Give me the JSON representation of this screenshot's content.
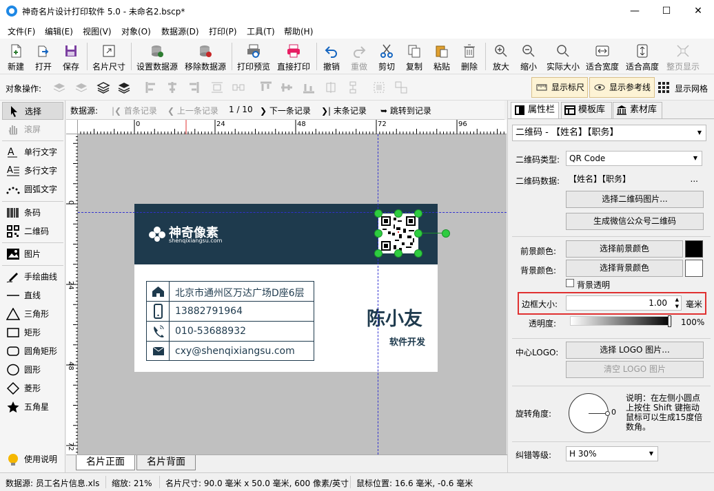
{
  "window": {
    "title": "神奇名片设计打印软件 5.0 - 未命名2.bscp*",
    "minimize": "—",
    "maximize": "☐",
    "close": "✕"
  },
  "menu": [
    "文件(F)",
    "编辑(E)",
    "视图(V)",
    "对象(O)",
    "数据源(D)",
    "打印(P)",
    "工具(T)",
    "帮助(H)"
  ],
  "toolbar": {
    "new": "新建",
    "open": "打开",
    "save": "保存",
    "card_size": "名片尺寸",
    "set_datasource": "设置数据源",
    "remove_datasource": "移除数据源",
    "print_preview": "打印预览",
    "direct_print": "直接打印",
    "undo": "撤销",
    "redo": "重做",
    "cut": "剪切",
    "copy": "复制",
    "paste": "粘贴",
    "delete": "删除",
    "zoom_in": "放大",
    "zoom_out": "缩小",
    "actual_size": "实际大小",
    "fit_width": "适合宽度",
    "fit_height": "适合高度",
    "fit_page": "整页显示"
  },
  "objbar": {
    "label": "对象操作:",
    "show_ruler": "显示标尺",
    "show_guides": "显示参考线",
    "show_grid": "显示网格"
  },
  "tools": {
    "select": "选择",
    "scroll": "滚屏",
    "single_text": "单行文字",
    "multi_text": "多行文字",
    "arc_text": "圆弧文字",
    "barcode": "条码",
    "qrcode": "二维码",
    "image": "图片",
    "freehand": "手绘曲线",
    "line": "直线",
    "triangle": "三角形",
    "rect": "矩形",
    "rounded_rect": "圆角矩形",
    "circle": "圆形",
    "diamond": "菱形",
    "star": "五角星",
    "help": "使用说明"
  },
  "datasource_nav": {
    "label": "数据源:",
    "first": "首条记录",
    "prev": "上一条记录",
    "position": "1 / 10",
    "next": "下一条记录",
    "last": "末条记录",
    "jump": "跳转到记录"
  },
  "ruler": {
    "h_ticks": [
      "0",
      "24",
      "48",
      "72",
      "96"
    ],
    "v_ticks": [
      "0",
      "24",
      "48",
      "72"
    ]
  },
  "card": {
    "logo_text": "神奇像素",
    "logo_sub": "shenqixiangsu.com",
    "contacts": [
      "北京市通州区万达广场D座6层",
      "13882791964",
      "010-53688932",
      "cxy@shenqixiangsu.com"
    ],
    "name": "陈小友",
    "job": "软件开发"
  },
  "page_tabs": [
    "名片正面",
    "名片背面"
  ],
  "right_panel": {
    "tabs": [
      "属性栏",
      "模板库",
      "素材库"
    ],
    "object_select": "二维码 - 【姓名】【职务】",
    "qr_type_label": "二维码类型:",
    "qr_type_value": "QR Code",
    "qr_data_label": "二维码数据:",
    "qr_data_value": "【姓名】【职务】",
    "qr_data_more": "...",
    "select_qr_image": "选择二维码图片...",
    "gen_wechat_qr": "生成微信公众号二维码",
    "fg_label": "前景颜色:",
    "fg_btn": "选择前景颜色",
    "fg_color": "#000000",
    "bg_label": "背景颜色:",
    "bg_btn": "选择背景颜色",
    "bg_color": "#ffffff",
    "bg_transparent": "背景透明",
    "border_label": "边框大小:",
    "border_value": "1.00",
    "border_unit": "毫米",
    "opacity_label": "透明度:",
    "opacity_value": "100%",
    "center_logo_label": "中心LOGO:",
    "select_logo": "选择 LOGO 图片...",
    "clear_logo": "清空  LOGO 图片",
    "rotation_label": "旋转角度:",
    "rotation_value": "0",
    "rotation_note": "说明：在左侧小圆点上按住 Shift 键拖动鼠标可以生成15度倍数角。",
    "ecc_label": "纠错等级:",
    "ecc_value": "H 30%"
  },
  "status": {
    "datasource": "数据源: 员工名片信息.xls",
    "zoom": "缩放: 21%",
    "card_size": "名片尺寸: 90.0 毫米 x 50.0 毫米, 600 像素/英寸",
    "cursor": "鼠标位置: 16.6 毫米, -0.6 毫米"
  },
  "colors": {
    "card_dark": "#1e3a4d",
    "handle": "#2ecc40",
    "highlight": "#e03030"
  }
}
